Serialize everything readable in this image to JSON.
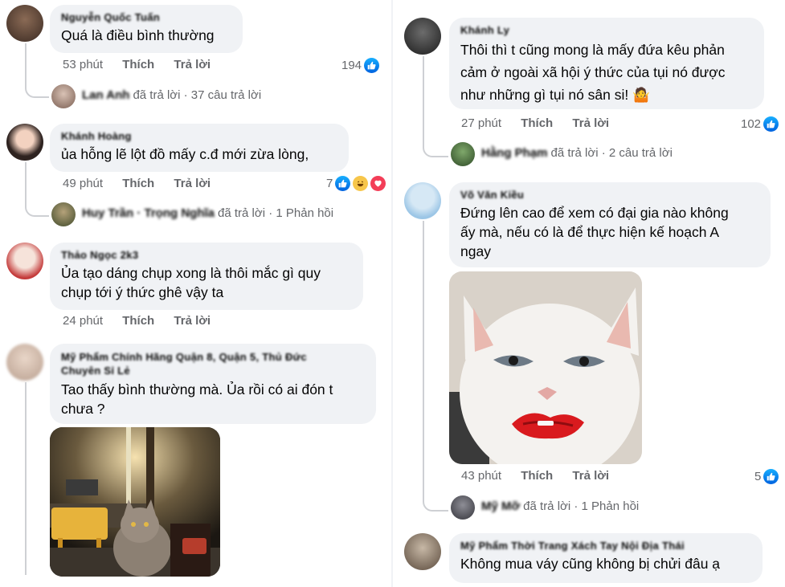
{
  "left": {
    "c1": {
      "author": "Nguyễn Quốc Tuấn",
      "text": "Quá là điều bình thường",
      "time": "53 phút",
      "like": "Thích",
      "reply": "Trả lời",
      "reacts": "194",
      "replies": {
        "name": "Lan Anh",
        "summary": "đã trả lời · 37 câu trả lời"
      }
    },
    "c2": {
      "author": "Khánh Hoàng",
      "text": "ủa hỗng lẽ lột đồ mấy c.đ mới zừa lòng,",
      "time": "49 phút",
      "like": "Thích",
      "reply": "Trả lời",
      "reacts": "7",
      "replies": {
        "name": "Huy Trần · Trọng Nghĩa",
        "summary": "đã trả lời · 1 Phản hồi"
      }
    },
    "c3": {
      "author": "Thảo Ngọc 2k3",
      "text_l1": "Ủa tạo dáng chụp xong là thôi mắc gì quy",
      "text_l2": "chụp tới ý thức ghê vậy ta",
      "time": "24 phút",
      "like": "Thích",
      "reply": "Trả lời"
    },
    "c4": {
      "author_l1": "Mỹ Phẩm Chính Hãng Quận 8, Quận 5, Thủ Đức",
      "author_l2": "Chuyên Sỉ Lẻ",
      "text_l1": "Tao thấy bình thường mà. Ủa rồi có ai đón t",
      "text_l2": "chưa ?"
    }
  },
  "right": {
    "c1": {
      "author": "Khánh Ly",
      "text_l1": "Thôi thì t cũng mong là mấy đứa kêu phản",
      "text_l2": "cảm ở ngoài xã hội ý thức của tụi nó được",
      "text_l3": "như những gì tụi nó sân si! 🤷",
      "time": "27 phút",
      "like": "Thích",
      "reply": "Trả lời",
      "reacts": "102",
      "replies": {
        "name": "Hằng Phạm",
        "summary": "đã trả lời · 2 câu trả lời"
      }
    },
    "c2": {
      "author": "Võ Văn Kiều",
      "text_l1": "Đứng lên cao để xem có đại gia nào không",
      "text_l2": "ấy mà, nếu có là để thực hiện kế hoạch A",
      "text_l3": "ngay",
      "time": "43 phút",
      "like": "Thích",
      "reply": "Trả lời",
      "reacts": "5",
      "replies": {
        "name": "Mỹ Mỡ",
        "summary": "đã trả lời · 1 Phản hồi"
      }
    },
    "c3": {
      "author": "Mỹ Phẩm Thời Trang Xách Tay Nội Địa Thái",
      "text": "Không mua váy cũng không bị chửi đâu ạ"
    }
  },
  "colors": {
    "bubble": "#f0f2f5",
    "meta": "#65676b",
    "like": "#1877f2",
    "thread": "#ced0d4"
  }
}
